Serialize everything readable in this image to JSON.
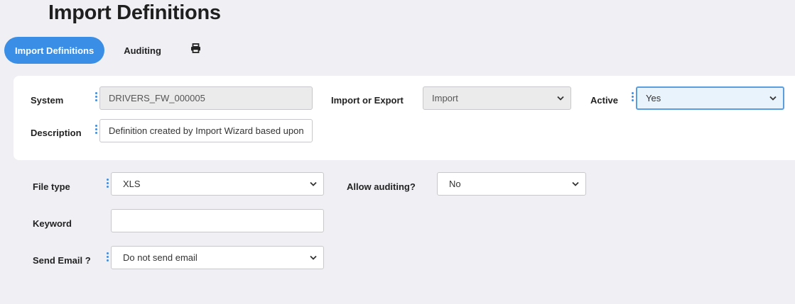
{
  "page": {
    "title": "Import Definitions"
  },
  "tabs": {
    "active_label": "Import Definitions",
    "auditing_label": "Auditing",
    "print_icon": "printer-icon"
  },
  "header_form": {
    "system": {
      "label": "System",
      "value": "DRIVERS_FW_000005"
    },
    "import_or_export": {
      "label": "Import or Export",
      "value": "Import"
    },
    "active": {
      "label": "Active",
      "value": "Yes"
    },
    "description": {
      "label": "Description",
      "value": "Definition created by Import Wizard based upon"
    }
  },
  "details_form": {
    "file_type": {
      "label": "File type",
      "value": "XLS"
    },
    "allow_auditing": {
      "label": "Allow auditing?",
      "value": "No"
    },
    "keyword": {
      "label": "Keyword",
      "value": ""
    },
    "send_email": {
      "label": "Send Email ?",
      "value": "Do not send email"
    }
  },
  "colors": {
    "accent": "#3a8ee6",
    "background": "#f0eff4"
  }
}
